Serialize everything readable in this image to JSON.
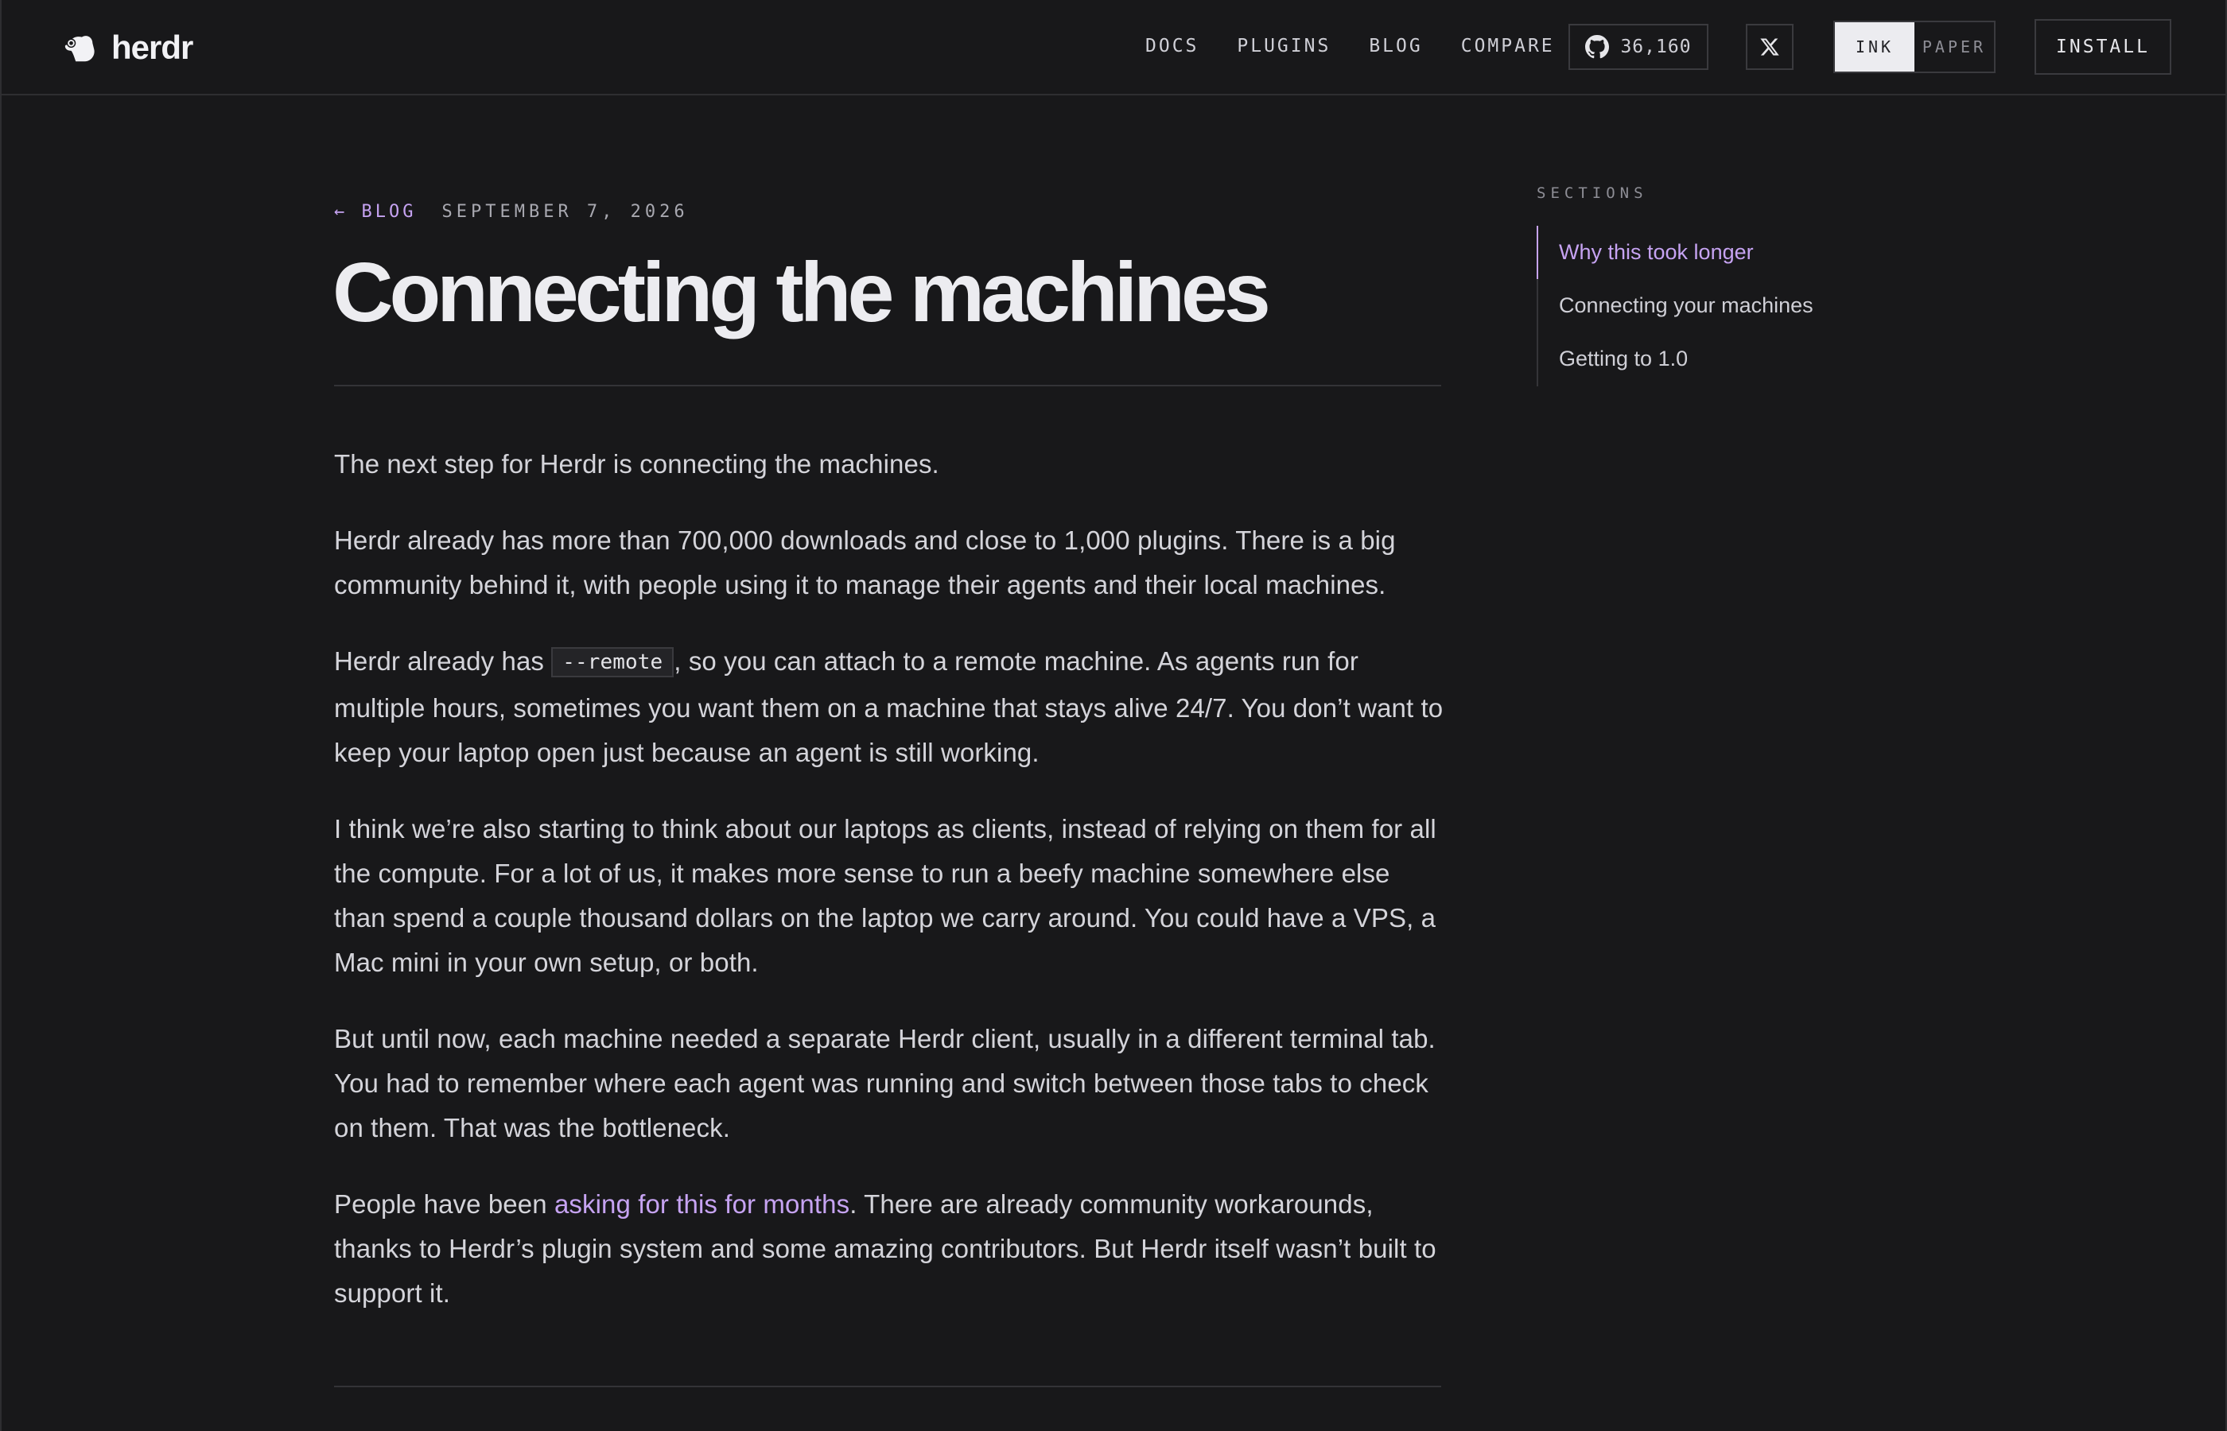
{
  "header": {
    "logo_text": "herdr",
    "nav": [
      "DOCS",
      "PLUGINS",
      "BLOG",
      "COMPARE"
    ],
    "github_stars": "36,160",
    "theme_options": [
      "INK",
      "PAPER"
    ],
    "theme_active": "INK",
    "install_label": "INSTALL"
  },
  "article": {
    "back_label": "← BLOG",
    "date": "SEPTEMBER 7, 2026",
    "title": "Connecting the machines",
    "p1": "The next step for Herdr is connecting the machines.",
    "p2": "Herdr already has more than 700,000 downloads and close to 1,000 plugins. There is a big community behind it, with people using it to manage their agents and their local machines.",
    "p3_before": "Herdr already has ",
    "p3_code": "--remote",
    "p3_after": ", so you can attach to a remote machine. As agents run for multiple hours, sometimes you want them on a machine that stays alive 24/7. You don’t want to keep your laptop open just because an agent is still working.",
    "p4": "I think we’re also starting to think about our laptops as clients, instead of relying on them for all the compute. For a lot of us, it makes more sense to run a beefy machine somewhere else than spend a couple thousand dollars on the laptop we carry around. You could have a VPS, a Mac mini in your own setup, or both.",
    "p5": "But until now, each machine needed a separate Herdr client, usually in a different terminal tab. You had to remember where each agent was running and switch between those tabs to check on them. That was the bottleneck.",
    "p6_before": "People have been ",
    "p6_link": "asking for this for months",
    "p6_after": ". There are already community workarounds, thanks to Herdr’s plugin system and some amazing contributors. But Herdr itself wasn’t built to support it."
  },
  "toc": {
    "label": "SECTIONS",
    "items": [
      "Why this took longer",
      "Connecting your machines",
      "Getting to 1.0"
    ],
    "active_index": 0
  },
  "colors": {
    "background": "#18181a",
    "accent": "#c6a3f2",
    "text": "#d4d4da",
    "border": "#2e2e31"
  },
  "icons": [
    "herdr-logo-icon",
    "github-icon",
    "x-icon"
  ]
}
